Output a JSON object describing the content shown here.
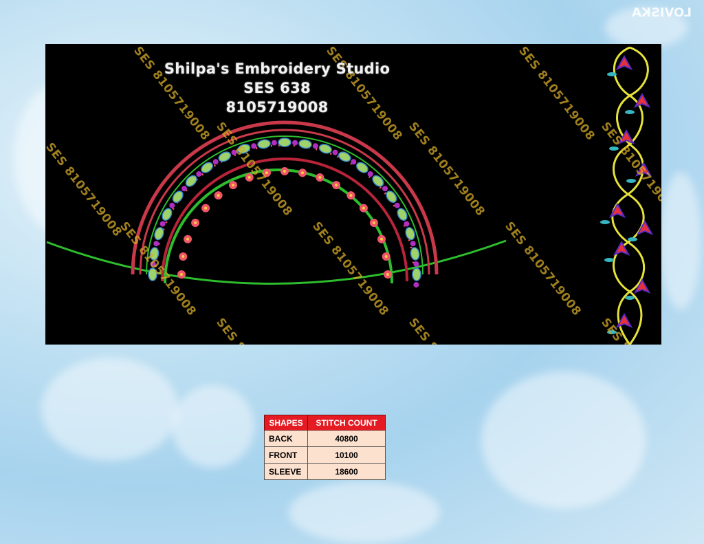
{
  "design": {
    "studio_name": "Shilpa's Embroidery Studio",
    "design_code": "SES 638",
    "phone": "8105719008",
    "watermark": "SES 8105719008",
    "corner_mark": "LOVISKA"
  },
  "stitch_table": {
    "headers": [
      "SHAPES",
      "STITCH COUNT"
    ],
    "rows": [
      {
        "shape": "BACK",
        "count": "40800"
      },
      {
        "shape": "FRONT",
        "count": "10100"
      },
      {
        "shape": "SLEEVE",
        "count": "18600"
      }
    ]
  },
  "colors": {
    "design_background": "#000000",
    "arch_green": "#2dbd2d",
    "flower_pink": "#f0566a",
    "paisley_green": "#9fd36a",
    "vine_yellow": "#e6e23a",
    "leaf_teal": "#35b6c0",
    "table_header": "#e41b23",
    "table_cell": "#fde1cf"
  }
}
